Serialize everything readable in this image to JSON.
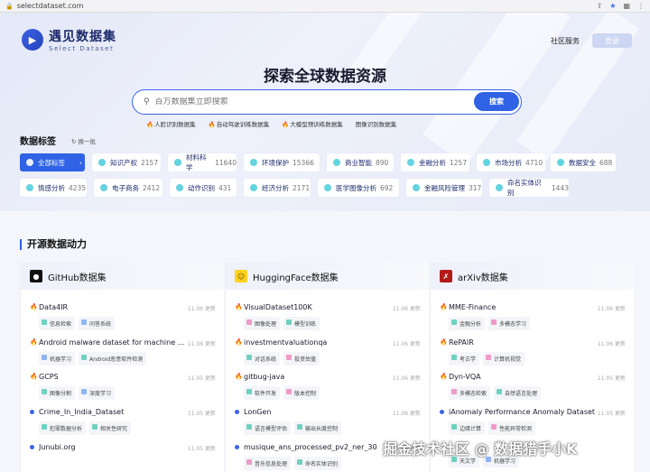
{
  "browser": {
    "url": "selectdataset.com"
  },
  "header": {
    "logo_cn": "遇见数据集",
    "logo_en": "Select Dataset",
    "nav_community": "社区服务",
    "login": "登录"
  },
  "hero": {
    "title": "探索全球数据资源",
    "search_placeholder": "百万数据集立即搜索",
    "search_button": "搜索",
    "hot": [
      "人脸识别数据集",
      "自动驾驶训练数据集",
      "大模型预训练数据集",
      "图像识别数据集"
    ]
  },
  "tags": {
    "title": "数据标签",
    "refresh": "换一批",
    "row1": [
      {
        "label": "全部标签",
        "count": ""
      },
      {
        "label": "知识产权",
        "count": "2157"
      },
      {
        "label": "材料科学",
        "count": "11640"
      },
      {
        "label": "环境保护",
        "count": "15366"
      },
      {
        "label": "商业智能",
        "count": "890"
      },
      {
        "label": "金融分析",
        "count": "1257"
      },
      {
        "label": "市场分析",
        "count": "4710"
      },
      {
        "label": "数据安全",
        "count": "688"
      }
    ],
    "row2": [
      {
        "label": "情感分析",
        "count": "4235"
      },
      {
        "label": "电子商务",
        "count": "2412"
      },
      {
        "label": "动作识别",
        "count": "431"
      },
      {
        "label": "经济分析",
        "count": "2171"
      },
      {
        "label": "医学图像分析",
        "count": "692"
      },
      {
        "label": "金融风险管理",
        "count": "317"
      },
      {
        "label": "命名实体识别",
        "count": "1443"
      }
    ]
  },
  "section": {
    "title": "开源数据动力",
    "columns": [
      {
        "title": "GitHub数据集",
        "items": [
          {
            "name": "Data4IR",
            "date": "11.06 更新",
            "chips": [
              "信息检索",
              "问答系统"
            ]
          },
          {
            "name": "Android malware dataset for machine ...",
            "date": "11.06 更新",
            "chips": [
              "机器学习",
              "Android恶意软件检测"
            ]
          },
          {
            "name": "GCPS",
            "date": "11.05 更新",
            "chips": [
              "图像分割",
              "深度学习"
            ]
          },
          {
            "name": "Crime_In_India_Dataset",
            "date": "11.05 更新",
            "chips": [
              "犯罪数据分析",
              "相关性研究"
            ]
          },
          {
            "name": "Junubi.org",
            "date": "11.05 更新",
            "chips": []
          }
        ]
      },
      {
        "title": "HuggingFace数据集",
        "items": [
          {
            "name": "VisualDataset100K",
            "date": "11.06 更新",
            "chips": [
              "图像处理",
              "模型训练"
            ]
          },
          {
            "name": "investmentvaluationqa",
            "date": "11.06 更新",
            "chips": [
              "对话系统",
              "投资估值"
            ]
          },
          {
            "name": "gitbug-java",
            "date": "11.06 更新",
            "chips": [
              "软件开发",
              "版本控制"
            ]
          },
          {
            "name": "LonGen",
            "date": "11.06 更新",
            "chips": [
              "语言模型评估",
              "输出长度控制"
            ]
          },
          {
            "name": "musique_ans_processed_pv2_ner_30",
            "date": "11.06 更新",
            "chips": [
              "音乐信息处理",
              "命名实体识别"
            ]
          }
        ]
      },
      {
        "title": "arXiv数据集",
        "items": [
          {
            "name": "MME-Finance",
            "date": "11.06 更新",
            "chips": [
              "金融分析",
              "多模态学习"
            ]
          },
          {
            "name": "RePAIR",
            "date": "11.06 更新",
            "chips": [
              "考古学",
              "计算机视觉"
            ]
          },
          {
            "name": "Dyn-VQA",
            "date": "11.05 更新",
            "chips": [
              "多模态检索",
              "自然语言处理"
            ]
          },
          {
            "name": "iAnomaly Performance Anomaly Dataset",
            "date": "11.05 更新",
            "chips": [
              "边缘计算",
              "性能异常检测"
            ]
          },
          {
            "name": "",
            "date": "",
            "chips": [
              "天文学",
              "机器学习"
            ]
          }
        ]
      }
    ]
  },
  "watermark": "掘金技术社区 @ 数据猎手小K"
}
